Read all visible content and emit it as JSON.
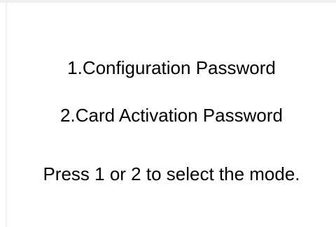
{
  "menu": {
    "options": [
      "1.Configuration Password",
      "2.Card Activation Password"
    ],
    "instruction": "Press 1 or 2 to select the mode."
  }
}
